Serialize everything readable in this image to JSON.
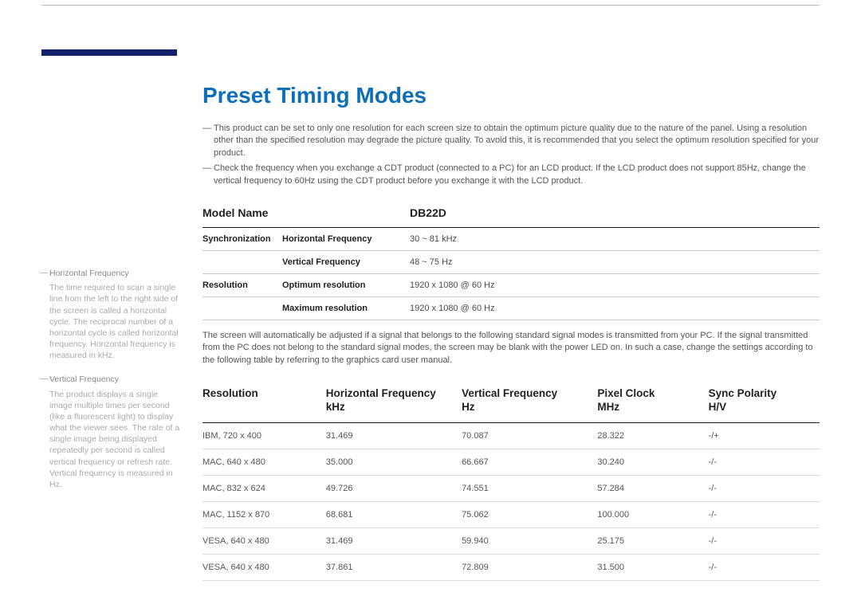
{
  "title": "Preset Timing Modes",
  "notes": [
    "This product can be set to only one resolution for each screen size to obtain the optimum picture quality due to the nature of the panel. Using a resolution other than the specified resolution may degrade the picture quality. To avoid this, it is recommended that you select the optimum resolution specified for your product.",
    "Check the frequency when you exchange a CDT product (connected to a PC) for an LCD product. If the LCD product does not support 85Hz, change the vertical frequency to 60Hz using the CDT product before you exchange it with the LCD product."
  ],
  "spec": {
    "modelNameLabel": "Model Name",
    "modelName": "DB22D",
    "rows": [
      {
        "group": "Synchronization",
        "label": "Horizontal Frequency",
        "value": "30 ~ 81 kHz"
      },
      {
        "group": "",
        "label": "Vertical Frequency",
        "value": "48 ~ 75 Hz"
      },
      {
        "group": "Resolution",
        "label": "Optimum resolution",
        "value": "1920 x 1080 @ 60 Hz"
      },
      {
        "group": "",
        "label": "Maximum resolution",
        "value": "1920 x 1080 @ 60 Hz"
      }
    ]
  },
  "midText": "The screen will automatically be adjusted if a signal that belongs to the following standard signal modes is transmitted from your PC. If the signal transmitted from the PC does not belong to the standard signal modes, the screen may be blank with the power LED on. In such a case, change the settings according to the following table by referring to the graphics card user manual.",
  "timing": {
    "headers": {
      "resolution": "Resolution",
      "hfreq": "Horizontal Frequency",
      "hfreqUnit": "kHz",
      "vfreq": "Vertical Frequency",
      "vfreqUnit": "Hz",
      "pclock": "Pixel Clock",
      "pclockUnit": "MHz",
      "sync": "Sync Polarity",
      "syncUnit": "H/V"
    },
    "rows": [
      {
        "res": "IBM, 720 x 400",
        "h": "31.469",
        "v": "70.087",
        "p": "28.322",
        "s": "-/+"
      },
      {
        "res": "MAC, 640 x 480",
        "h": "35.000",
        "v": "66.667",
        "p": "30.240",
        "s": "-/-"
      },
      {
        "res": "MAC, 832 x 624",
        "h": "49.726",
        "v": "74.551",
        "p": "57.284",
        "s": "-/-"
      },
      {
        "res": "MAC, 1152 x 870",
        "h": "68.681",
        "v": "75.062",
        "p": "100.000",
        "s": "-/-"
      },
      {
        "res": "VESA, 640 x 480",
        "h": "31.469",
        "v": "59.940",
        "p": "25.175",
        "s": "-/-"
      },
      {
        "res": "VESA, 640 x 480",
        "h": "37.861",
        "v": "72.809",
        "p": "31.500",
        "s": "-/-"
      }
    ]
  },
  "sidebar": {
    "items": [
      {
        "term": "Horizontal Frequency",
        "desc": "The time required to scan a single line from the left to the right side of the screen is called a horizontal cycle. The reciprocal number of a horizontal cycle is called horizontal frequency. Horizontal frequency is measured in kHz."
      },
      {
        "term": "Vertical Frequency",
        "desc": "The product displays a single image multiple times per second (like a fluorescent light) to display what the viewer sees. The rate of a single image being displayed repeatedly per second is called vertical frequency or refresh rate. Vertical frequency is measured in Hz."
      }
    ]
  }
}
